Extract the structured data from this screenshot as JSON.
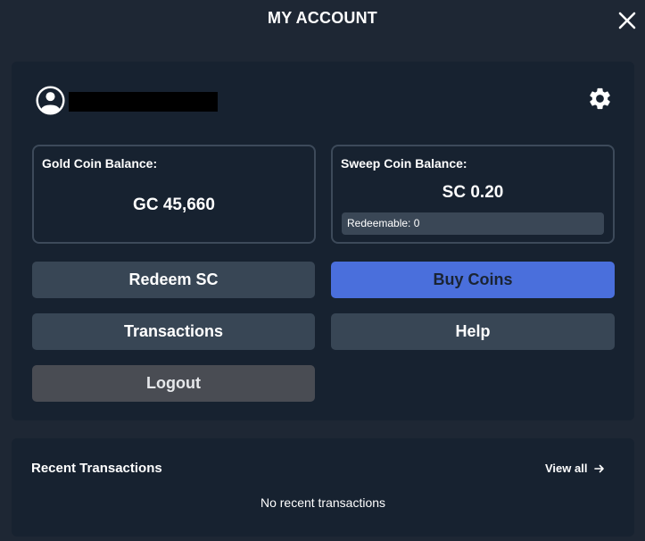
{
  "header": {
    "title": "MY ACCOUNT",
    "close_icon": "close-icon"
  },
  "account": {
    "avatar_icon": "user-circle-icon",
    "username_redacted": true,
    "settings_icon": "gear-icon",
    "gold": {
      "label": "Gold Coin Balance:",
      "value": "GC 45,660"
    },
    "sweep": {
      "label": "Sweep Coin Balance:",
      "value": "SC 0.20",
      "redeemable": "Redeemable: 0"
    },
    "buttons": {
      "redeem": "Redeem SC",
      "buy": "Buy Coins",
      "transactions": "Transactions",
      "help": "Help",
      "logout": "Logout"
    }
  },
  "recent": {
    "title": "Recent Transactions",
    "view_all": "View all",
    "view_all_icon": "arrow-right-icon",
    "empty": "No recent transactions"
  },
  "colors": {
    "background": "#1e2734",
    "card": "#172230",
    "button_slate": "#384655",
    "button_blue": "#4a6fdc",
    "button_gray": "#494c53"
  }
}
